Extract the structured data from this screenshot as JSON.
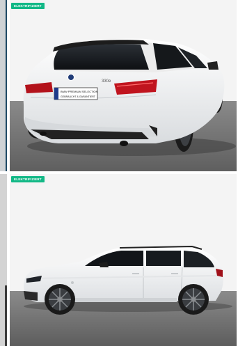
{
  "listing": {
    "photos": [
      {
        "badge": "ELEKTRIFIZIERT",
        "plate_line1": "BMW PREMIUM SELECTION",
        "plate_line2": "GEBRAUCHT & GARANTIERT",
        "model_badge": "330e",
        "view": "rear"
      },
      {
        "badge": "ELEKTRIFIZIERT",
        "view": "side"
      }
    ]
  },
  "colors": {
    "badge_bg": "#12b886",
    "car_body": "#f2f3f4",
    "floor": "#6c6c6c",
    "backdrop": "#f3f3f3"
  }
}
